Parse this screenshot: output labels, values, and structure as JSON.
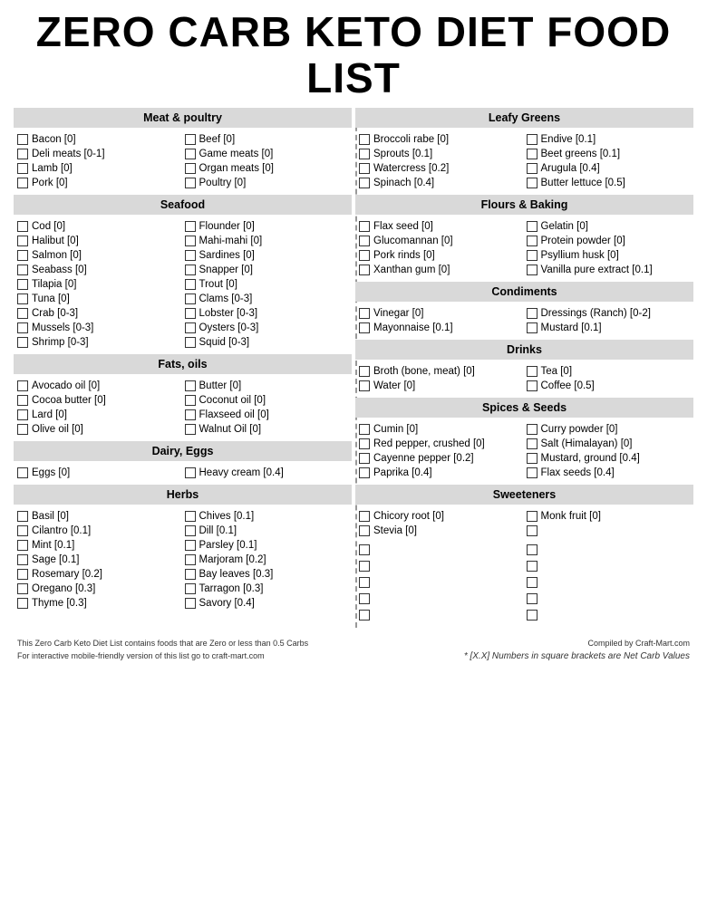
{
  "title": "ZERO CARB KETO DIET FOOD LIST",
  "left_column": [
    {
      "header": "Meat & poultry",
      "items": [
        [
          "Bacon [0]",
          "Beef [0]"
        ],
        [
          "Deli meats [0-1]",
          "Game meats [0]"
        ],
        [
          "Lamb [0]",
          "Organ meats [0]"
        ],
        [
          "Pork [0]",
          "Poultry [0]"
        ]
      ]
    },
    {
      "header": "Seafood",
      "items": [
        [
          "Cod [0]",
          "Flounder [0]"
        ],
        [
          "Halibut [0]",
          "Mahi-mahi [0]"
        ],
        [
          "Salmon [0]",
          "Sardines [0]"
        ],
        [
          "Seabass [0]",
          "Snapper [0]"
        ],
        [
          "Tilapia [0]",
          "Trout [0]"
        ],
        [
          "Tuna [0]",
          "Clams [0-3]"
        ],
        [
          "Crab [0-3]",
          "Lobster [0-3]"
        ],
        [
          "Mussels [0-3]",
          "Oysters [0-3]"
        ],
        [
          "Shrimp [0-3]",
          "Squid [0-3]"
        ]
      ]
    },
    {
      "header": "Fats, oils",
      "items": [
        [
          "Avocado oil [0]",
          "Butter [0]"
        ],
        [
          "Cocoa butter [0]",
          "Coconut oil [0]"
        ],
        [
          "Lard [0]",
          "Flaxseed oil [0]"
        ],
        [
          "Olive oil [0]",
          "Walnut Oil [0]"
        ]
      ]
    },
    {
      "header": "Dairy, Eggs",
      "items": [
        [
          "Eggs [0]",
          "Heavy cream [0.4]"
        ]
      ]
    },
    {
      "header": "Herbs",
      "items": [
        [
          "Basil [0]",
          "Chives [0.1]"
        ],
        [
          "Cilantro [0.1]",
          "Dill [0.1]"
        ],
        [
          "Mint [0.1]",
          "Parsley [0.1]"
        ],
        [
          "Sage [0.1]",
          "Marjoram [0.2]"
        ],
        [
          "Rosemary [0.2]",
          "Bay leaves [0.3]"
        ],
        [
          "Oregano [0.3]",
          "Tarragon [0.3]"
        ],
        [
          "Thyme [0.3]",
          "Savory [0.4]"
        ]
      ]
    }
  ],
  "right_column": [
    {
      "header": "Leafy Greens",
      "items": [
        [
          "Broccoli rabe [0]",
          "Endive [0.1]"
        ],
        [
          "Sprouts [0.1]",
          "Beet greens [0.1]"
        ],
        [
          "Watercress [0.2]",
          "Arugula [0.4]"
        ],
        [
          "Spinach [0.4]",
          "Butter lettuce [0.5]"
        ]
      ]
    },
    {
      "header": "Flours & Baking",
      "items": [
        [
          "Flax seed [0]",
          "Gelatin [0]"
        ],
        [
          "Glucomannan [0]",
          "Protein powder [0]"
        ],
        [
          "Pork rinds [0]",
          "Psyllium husk [0]"
        ],
        [
          "Xanthan gum [0]",
          "Vanilla pure extract [0.1]"
        ]
      ]
    },
    {
      "header": "Condiments",
      "items": [
        [
          "Vinegar [0]",
          "Dressings (Ranch) [0-2]"
        ],
        [
          "Mayonnaise [0.1]",
          "Mustard [0.1]"
        ]
      ]
    },
    {
      "header": "Drinks",
      "items": [
        [
          "Broth (bone, meat) [0]",
          "Tea [0]"
        ],
        [
          "Water [0]",
          "Coffee [0.5]"
        ]
      ]
    },
    {
      "header": "Spices & Seeds",
      "items": [
        [
          "Cumin [0]",
          "Curry powder [0]"
        ],
        [
          "Red pepper, crushed [0]",
          "Salt (Himalayan) [0]"
        ],
        [
          "Cayenne pepper [0.2]",
          "Mustard, ground [0.4]"
        ],
        [
          "Paprika [0.4]",
          "Flax seeds [0.4]"
        ]
      ]
    },
    {
      "header": "Sweeteners",
      "items": [
        [
          "Chicory root [0]",
          "Monk fruit [0]"
        ],
        [
          "Stevia [0]",
          ""
        ]
      ]
    }
  ],
  "footer": {
    "left_line1": "This Zero Carb Keto Diet List contains foods that are Zero or less than 0.5 Carbs",
    "left_line2": "For interactive mobile-friendly version of this list go to craft-mart.com",
    "right_credit": "Compiled by Craft-Mart.com",
    "right_note": "* [X.X] Numbers in square brackets are Net Carb Values"
  }
}
